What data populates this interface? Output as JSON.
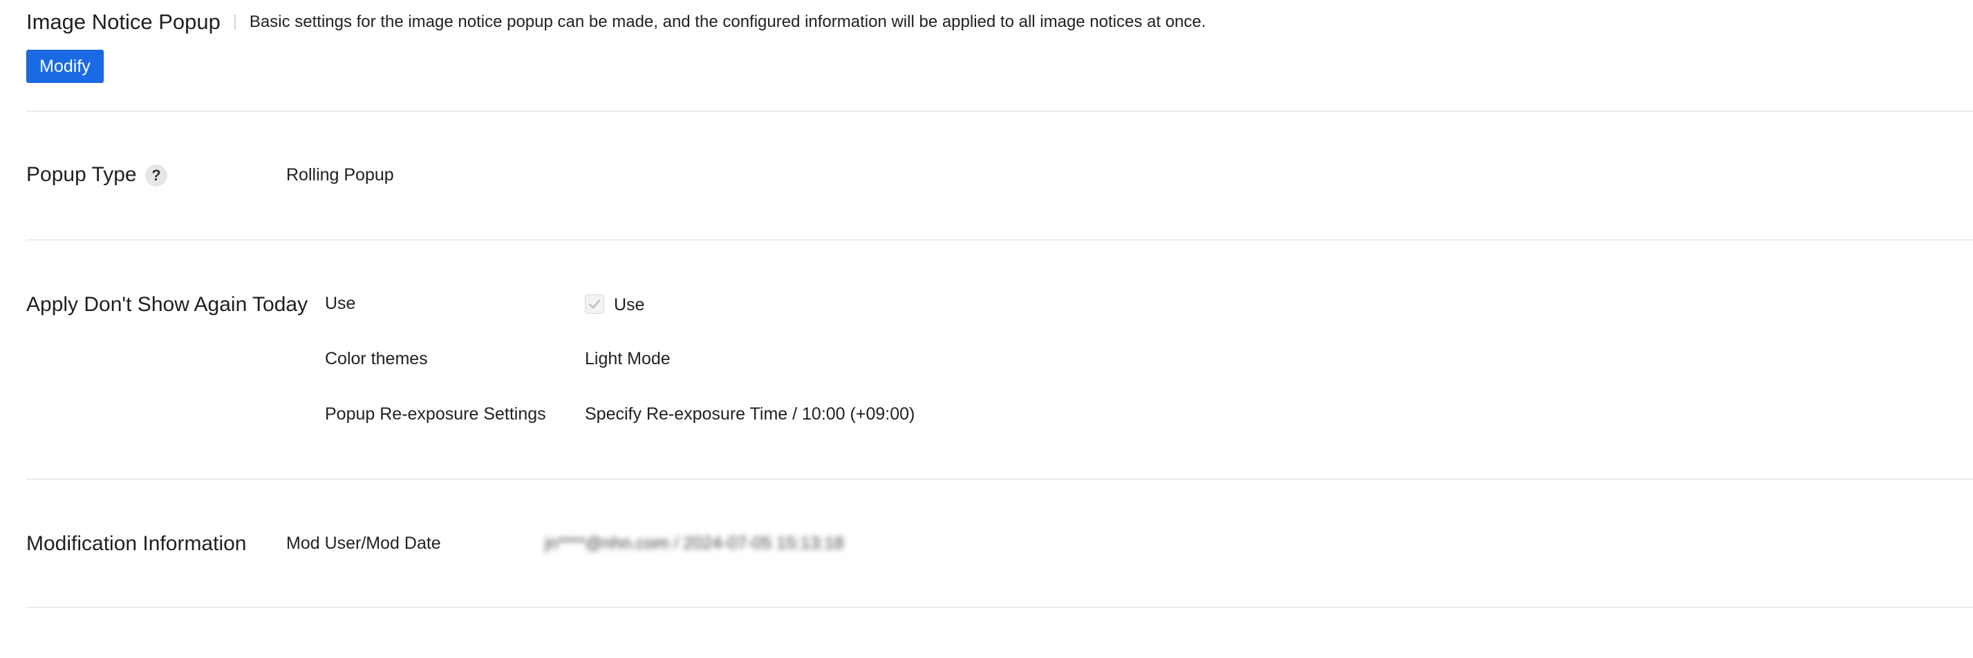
{
  "header": {
    "title": "Image Notice Popup",
    "description": "Basic settings for the image notice popup can be made, and the configured information will be applied to all image notices at once."
  },
  "toolbar": {
    "modify_label": "Modify"
  },
  "popup_type": {
    "title": "Popup Type",
    "help_glyph": "?",
    "value": "Rolling Popup"
  },
  "dont_show_again": {
    "title": "Apply Don't Show Again Today",
    "use_label": "Use",
    "use_checkbox_label": "Use",
    "use_checked": true,
    "color_themes_label": "Color themes",
    "color_themes_value": "Light Mode",
    "reexposure_label": "Popup Re-exposure Settings",
    "reexposure_value": "Specify Re-exposure Time / 10:00 (+09:00)"
  },
  "modification": {
    "title": "Modification Information",
    "mod_label": "Mod User/Mod Date",
    "mod_value": "jn****@nhn.com / 2024-07-05 15:13:18"
  },
  "colors": {
    "accent": "#1a6ae6",
    "divider": "#ececec"
  },
  "icons": {
    "help": "question-mark-icon",
    "checkbox": "checkmark-icon"
  }
}
